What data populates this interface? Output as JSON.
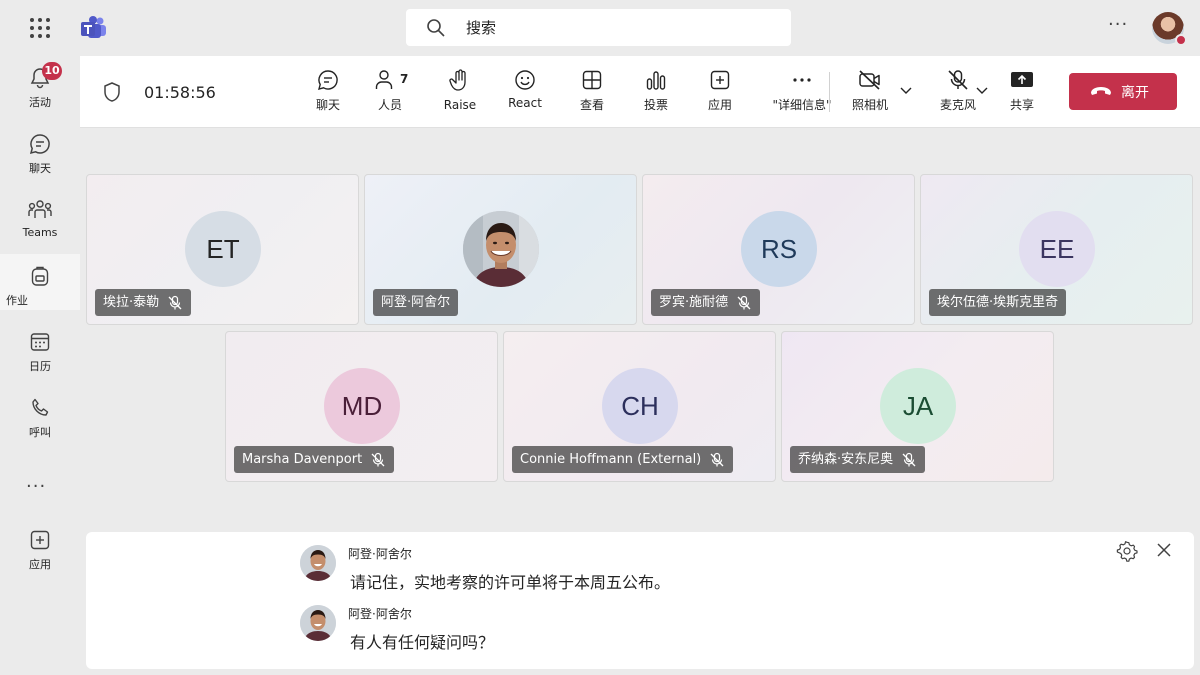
{
  "topbar": {
    "search_placeholder": "搜索",
    "more": "···"
  },
  "rail": {
    "items": [
      {
        "label": "活动",
        "icon": "bell-icon",
        "badge": "10"
      },
      {
        "label": "聊天",
        "icon": "chat-icon"
      },
      {
        "label": "Teams",
        "icon": "teams-icon"
      },
      {
        "label": "作业",
        "icon": "backpack-icon"
      },
      {
        "label": "日历",
        "icon": "calendar-icon"
      },
      {
        "label": "呼叫",
        "icon": "phone-icon"
      },
      {
        "label": "应用",
        "icon": "add-apps-icon"
      }
    ],
    "more": "···"
  },
  "toolbar": {
    "timer": "01:58:56",
    "buttons": [
      {
        "label": "聊天",
        "icon": "chat-icon"
      },
      {
        "label": "人员",
        "icon": "people-icon",
        "count": "7"
      },
      {
        "label": "Raise",
        "icon": "raise-hand-icon"
      },
      {
        "label": "React",
        "icon": "react-icon"
      },
      {
        "label": "查看",
        "icon": "view-icon"
      },
      {
        "label": "投票",
        "icon": "poll-icon"
      },
      {
        "label": "应用",
        "icon": "apps-icon"
      },
      {
        "label": "\"详细信息\"",
        "icon": "more-icon"
      },
      {
        "label": "照相机",
        "icon": "camera-off-icon"
      },
      {
        "label": "麦克风",
        "icon": "mic-off-icon"
      },
      {
        "label": "共享",
        "icon": "share-icon"
      }
    ],
    "leave_label": "离开",
    "leave_color": "#c4314b"
  },
  "participants": [
    {
      "name": "埃拉·泰勒",
      "initials": "ET",
      "avatar_bg": "#d6dde5",
      "initials_color": "#242424",
      "muted": true
    },
    {
      "name": "阿登·阿舍尔",
      "initials": "",
      "photo": true,
      "muted": false
    },
    {
      "name": "罗宾·施耐德",
      "initials": "RS",
      "avatar_bg": "#c9d8ea",
      "initials_color": "#1f3a5a",
      "muted": true
    },
    {
      "name": "埃尔伍德·埃斯克里奇",
      "initials": "EE",
      "avatar_bg": "#e2def0",
      "initials_color": "#3b3560",
      "muted": false
    },
    {
      "name": "Marsha Davenport",
      "initials": "MD",
      "avatar_bg": "#ecc9dc",
      "initials_color": "#4a1f38",
      "muted": true
    },
    {
      "name": "Connie Hoffmann (External)",
      "initials": "CH",
      "avatar_bg": "#d7d8ee",
      "initials_color": "#2c2f5c",
      "muted": true
    },
    {
      "name": "乔纳森·安东尼奥",
      "initials": "JA",
      "avatar_bg": "#cfecdc",
      "initials_color": "#1b4d33",
      "muted": true
    }
  ],
  "captions": [
    {
      "speaker": "阿登·阿舍尔",
      "text": "请记住，实地考察的许可单将于本周五公布。"
    },
    {
      "speaker": "阿登·阿舍尔",
      "text": "有人有任何疑问吗？"
    }
  ]
}
